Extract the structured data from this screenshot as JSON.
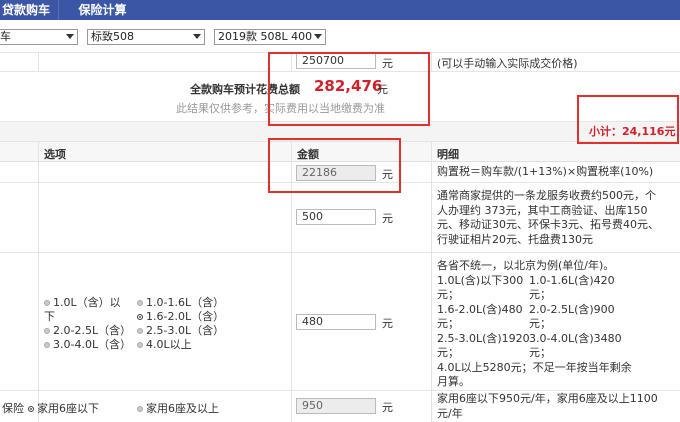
{
  "tabs": [
    "贷款购车",
    "保险计算"
  ],
  "selects": {
    "brand": "车",
    "model": "标致508",
    "version": "2019款 508L 400"
  },
  "price_row": {
    "value": "250700",
    "unit": "元",
    "hint": "(可以手动输入实际成交价格)"
  },
  "summary": {
    "label": "全款购车预计花费总额",
    "total": "282,476",
    "unit": "元",
    "note": "此结果仅供参考，实际费用以当地缴费为准"
  },
  "subtotal": "小计：24,116元",
  "table_headers": {
    "option": "选项",
    "amount": "金额",
    "detail": "明细"
  },
  "rows": {
    "tax": {
      "value": "22186",
      "unit": "元",
      "detail": "购置税＝购车款/(1+13%)×购置税率(10%)"
    },
    "plate": {
      "value": "500",
      "unit": "元",
      "detail": [
        "通常商家提供的一条龙服务收费约500元，个",
        "人办理约 373元，其中工商验证、出库150",
        "元、移动证30元、环保卡3元、拓号费40元、",
        "行驶证相片20元、托盘费130元"
      ]
    },
    "vehicle_tax": {
      "options": [
        "1.0L（含）以",
        "下",
        "1.0-1.6L（含）",
        "1.6-2.0L（含）",
        "2.0-2.5L（含）",
        "2.5-3.0L（含）",
        "3.0-4.0L（含）",
        "4.0L以上"
      ],
      "selected": "1.6-2.0L（含）",
      "value": "480",
      "unit": "元",
      "detail": [
        "各省不统一，以北京为例(单位/年)。",
        "1.0L(含)以下300",
        "元；",
        "1.0-1.6L(含)420",
        "元；",
        "1.6-2.0L(含)480",
        "元；",
        "2.0-2.5L(含)900",
        "元；",
        "2.5-3.0L(含)1920",
        "元；",
        "3.0-4.0L(含)3480",
        "元；",
        "4.0L以上5280元；不足一年按当年剩余",
        "月算。"
      ]
    },
    "insurance": {
      "label": "保险",
      "options": [
        "家用6座以下",
        "家用6座及以上"
      ],
      "selected": "家用6座以下",
      "value": "950",
      "unit": "元",
      "detail": [
        "家用6座以下950元/年，家用6座及以上1100",
        "元/年"
      ]
    }
  }
}
